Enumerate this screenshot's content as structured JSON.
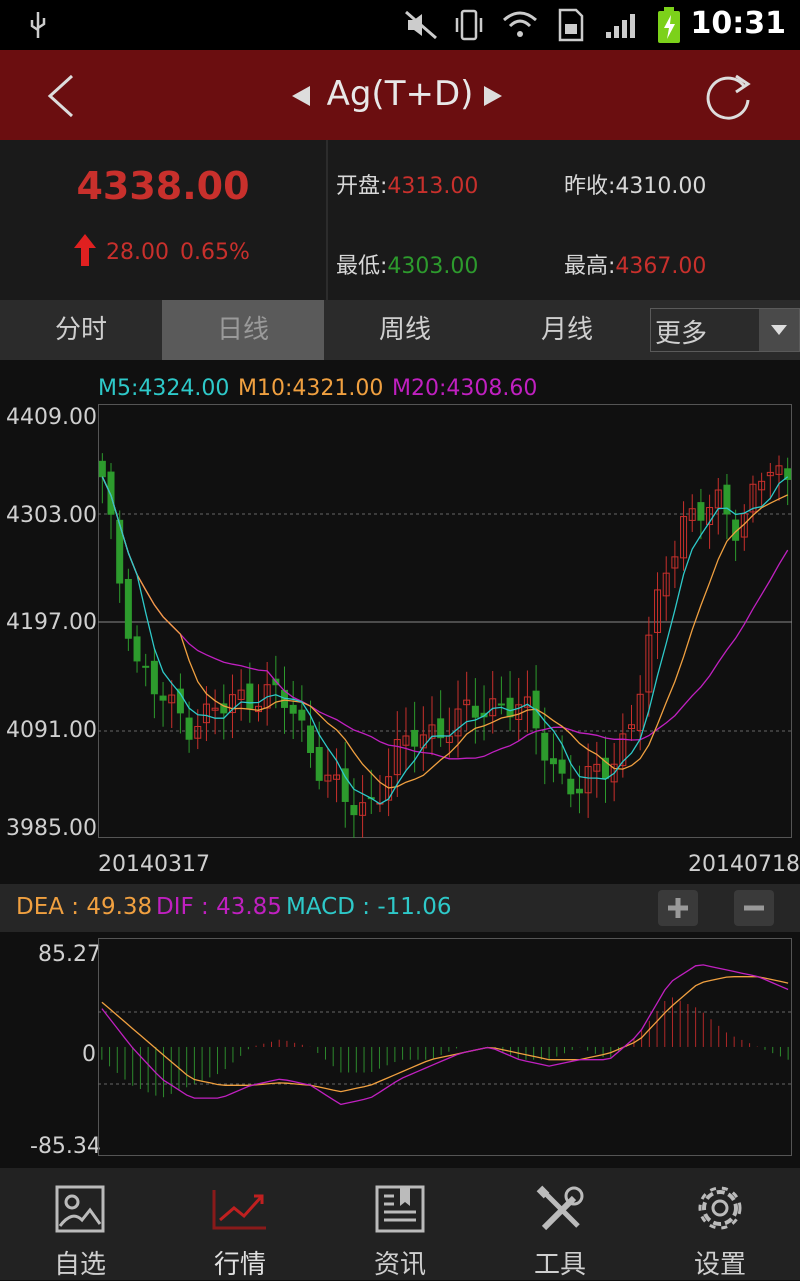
{
  "status_bar": {
    "time": "10:31"
  },
  "header": {
    "title": "Ag(T+D)"
  },
  "quote": {
    "price": "4338.00",
    "change": "28.00",
    "change_pct": "0.65%",
    "open_label": "开盘:",
    "open": "4313.00",
    "prev_close_label": "昨收:",
    "prev_close": "4310.00",
    "low_label": "最低:",
    "low": "4303.00",
    "high_label": "最高:",
    "high": "4367.00"
  },
  "tabs": [
    {
      "label": "分时"
    },
    {
      "label": "日线"
    },
    {
      "label": "周线"
    },
    {
      "label": "月线"
    }
  ],
  "more_select": {
    "selected": "更多"
  },
  "chart": {
    "ma5": "M5:4324.00",
    "ma10": "M10:4321.00",
    "ma20": "M20:4308.60",
    "y_ticks": [
      "4409.00",
      "4303.00",
      "4197.00",
      "4091.00",
      "3985.00"
    ],
    "x_start": "20140317",
    "x_end": "20140718"
  },
  "macd": {
    "dea": "DEA : 49.38",
    "dif": "DIF : 43.85",
    "macd": "MACD : -11.06",
    "y_ticks": [
      "85.27",
      "0",
      "-85.34"
    ]
  },
  "bottom_nav": [
    {
      "label": "自选",
      "icon": "image-icon"
    },
    {
      "label": "行情",
      "icon": "trend-icon"
    },
    {
      "label": "资讯",
      "icon": "news-icon"
    },
    {
      "label": "工具",
      "icon": "tools-icon"
    },
    {
      "label": "设置",
      "icon": "gear-icon"
    }
  ],
  "colors": {
    "header_bg": "#6b0e10",
    "up": "#c8302c",
    "down": "#2d9b2d",
    "ma5": "#2ec9c9",
    "ma10": "#f0a040",
    "ma20": "#c020c0"
  },
  "chart_data": {
    "type": "candlestick",
    "x_range": [
      "20140317",
      "20140718"
    ],
    "ylim": [
      3985.0,
      4409.0
    ],
    "close_approx": [
      4330,
      4240,
      4160,
      4130,
      4110,
      4100,
      4105,
      4110,
      4120,
      4130,
      4125,
      4110,
      4080,
      4050,
      4020,
      4010,
      4030,
      4060,
      4080,
      4090,
      4095,
      4100,
      4110,
      4120,
      4115,
      4100,
      4070,
      4040,
      4030,
      4050,
      4070,
      4100,
      4180,
      4260,
      4300,
      4300,
      4310,
      4295,
      4320,
      4345,
      4330
    ]
  },
  "macd_data": {
    "ylim": [
      -85.34,
      85.27
    ],
    "dif_approx": [
      30,
      0,
      -25,
      -40,
      -40,
      -30,
      -25,
      -30,
      -45,
      -40,
      -25,
      -15,
      -5,
      0,
      -10,
      -15,
      -10,
      -10,
      10,
      50,
      65,
      60,
      55,
      45
    ],
    "dea_approx": [
      35,
      15,
      -5,
      -25,
      -30,
      -30,
      -28,
      -30,
      -35,
      -30,
      -20,
      -10,
      -5,
      0,
      -5,
      -10,
      -10,
      -5,
      5,
      30,
      50,
      55,
      55,
      50
    ]
  }
}
